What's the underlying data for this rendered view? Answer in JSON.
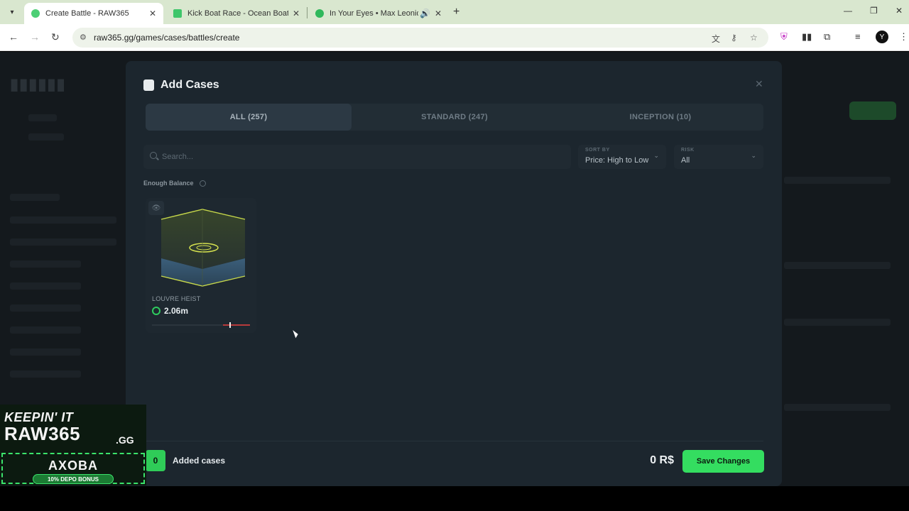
{
  "browser": {
    "tabs": [
      {
        "title": "Create Battle - RAW365",
        "active": true
      },
      {
        "title": "Kick Boat Race - Ocean Boat Sh",
        "active": false
      },
      {
        "title": "In Your Eyes • Max Leonidas",
        "active": false
      }
    ],
    "url": "raw365.gg/games/cases/battles/create",
    "icons": {
      "back": "arrow-left-icon",
      "forward": "arrow-right-icon",
      "reload": "reload-icon"
    }
  },
  "modal": {
    "title": "Add Cases",
    "tabs": [
      "ALL (257)",
      "STANDARD (247)",
      "INCEPTION (10)"
    ],
    "active_tab": 0,
    "search_placeholder": "Search...",
    "sort": {
      "label": "SORT BY",
      "value": "Price: High to Low"
    },
    "risk": {
      "label": "RISK",
      "value": "All"
    },
    "balance_filter": "Enough Balance",
    "cases": [
      {
        "name": "LOUVRE HEIST",
        "price": "2.06m",
        "risk_level": 0.79
      }
    ],
    "footer": {
      "added_count": "0",
      "added_label": "Added cases",
      "total": "0 R$",
      "save_label": "Save Changes"
    }
  },
  "promo": {
    "line1": "KEEPIN' IT",
    "line2": "RAW365",
    "tld": ".GG",
    "code": "AXOBA",
    "bonus": "10% DEPO BONUS"
  },
  "colors": {
    "accent_green": "#34dd60",
    "modal_bg": "#1c262e",
    "risk_red": "#b83b3b"
  }
}
